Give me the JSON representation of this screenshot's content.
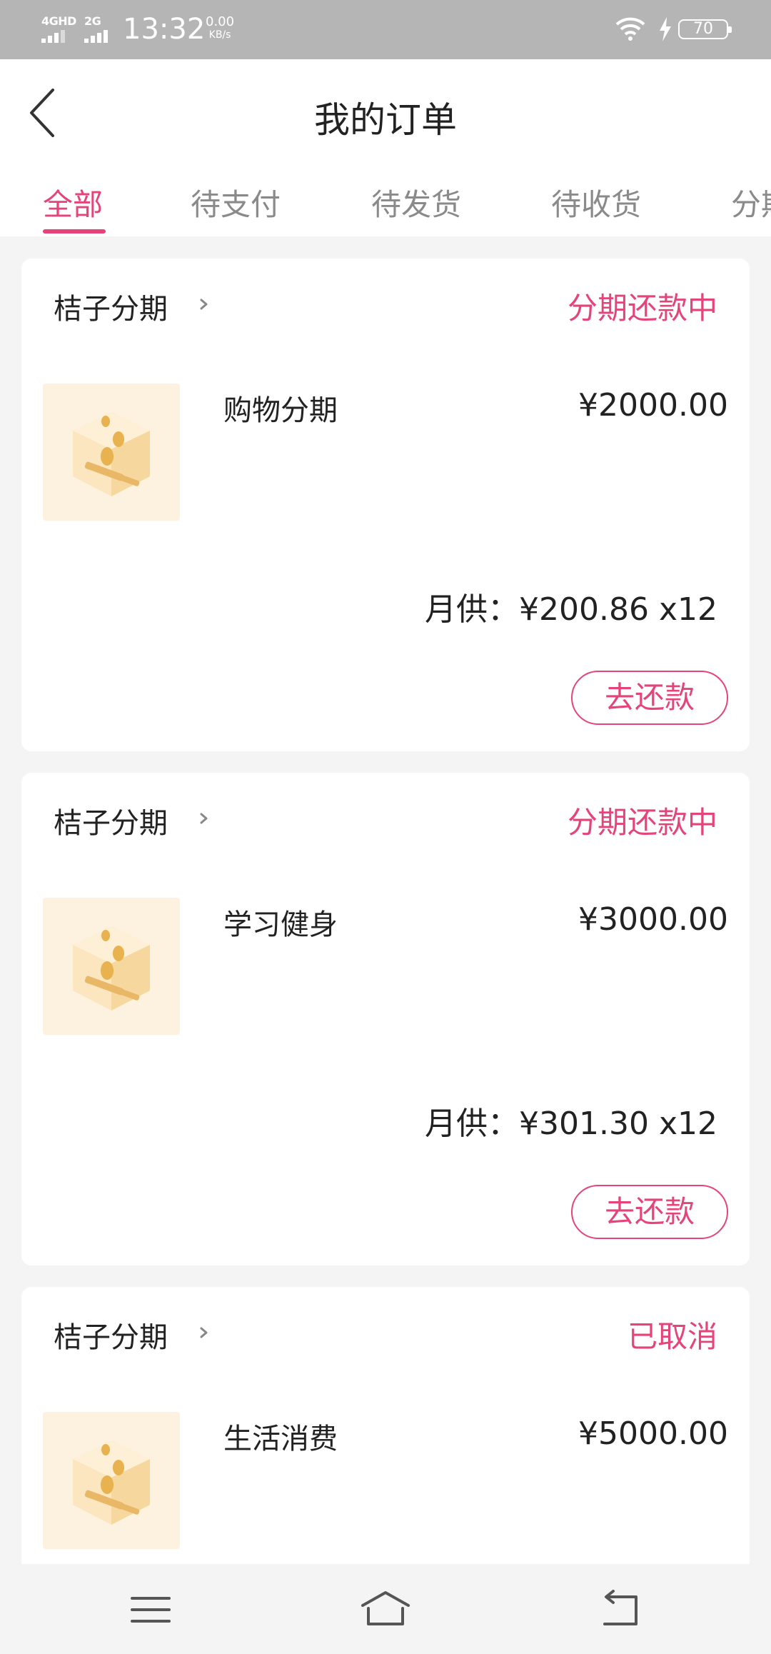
{
  "status_bar": {
    "net1_type": "4GHD",
    "net2_type": "2G",
    "time": "13:32",
    "speed_value": "0.00",
    "speed_unit": "KB/s",
    "battery_level": "70"
  },
  "header": {
    "title": "我的订单",
    "back_icon": "chevron-left-icon"
  },
  "tabs": [
    {
      "label": "全部",
      "active": true
    },
    {
      "label": "待支付",
      "active": false
    },
    {
      "label": "待发货",
      "active": false
    },
    {
      "label": "待收货",
      "active": false
    },
    {
      "label": "分期",
      "active": false
    }
  ],
  "orders": [
    {
      "store": "桔子分期",
      "status": "分期还款中",
      "product": "购物分期",
      "price": "¥2000.00",
      "monthly": "月供：¥200.86 x12",
      "action": "去还款"
    },
    {
      "store": "桔子分期",
      "status": "分期还款中",
      "product": "学习健身",
      "price": "¥3000.00",
      "monthly": "月供：¥301.30 x12",
      "action": "去还款"
    },
    {
      "store": "桔子分期",
      "status": "已取消",
      "product": "生活消费",
      "price": "¥5000.00"
    }
  ],
  "colors": {
    "accent": "#e5447a",
    "status_bar": "#b5b5b5",
    "background": "#f4f4f4"
  },
  "nav_icons": [
    "menu-icon",
    "home-icon",
    "back-icon"
  ]
}
